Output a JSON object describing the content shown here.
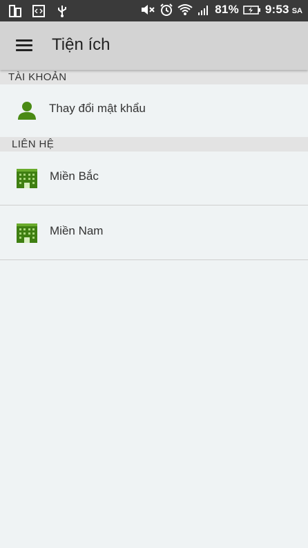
{
  "status_bar": {
    "battery_percent": "81%",
    "time": "9:53",
    "ampm": "SA",
    "icons": [
      "split-screen-icon",
      "code-icon",
      "usb-icon",
      "mute-icon",
      "alarm-icon",
      "wifi-icon",
      "signal-icon",
      "battery-charging-icon"
    ]
  },
  "app_bar": {
    "title": "Tiện ích",
    "menu_icon": "hamburger-menu-icon"
  },
  "sections": [
    {
      "header": "TÀI KHOẢN",
      "items": [
        {
          "label": "Thay đổi mật khẩu",
          "icon": "user-icon"
        }
      ]
    },
    {
      "header": "LIÊN HỆ",
      "items": [
        {
          "label": "Miền Bắc",
          "icon": "building-icon"
        },
        {
          "label": "Miền Nam",
          "icon": "building-icon"
        }
      ]
    }
  ],
  "colors": {
    "status_bar_bg": "#3a3a3a",
    "app_bar_bg": "#d3d3d3",
    "page_bg": "#eff3f4",
    "section_bg": "#e3e3e3",
    "icon_green": "#4a8a14"
  }
}
